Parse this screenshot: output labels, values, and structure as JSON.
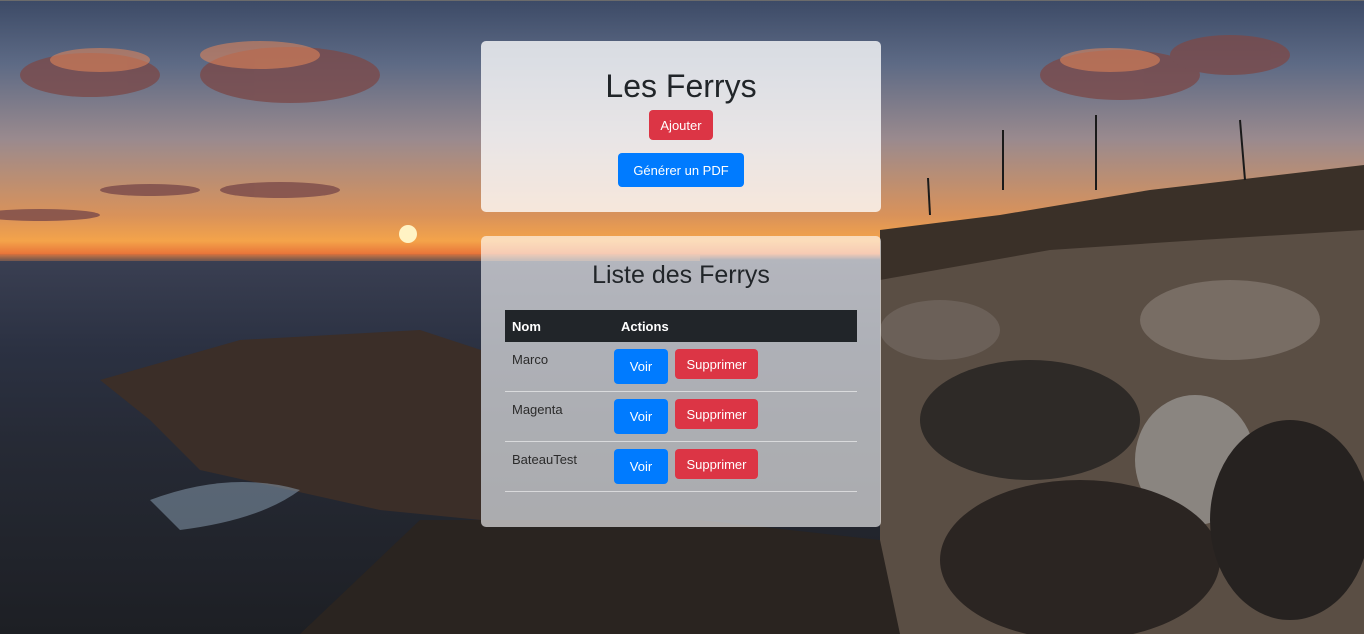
{
  "background": {
    "scene": "coastal-sunset-photo"
  },
  "header_card": {
    "title": "Les Ferrys",
    "add_button": "Ajouter",
    "pdf_button": "Générer un PDF"
  },
  "list_card": {
    "title": "Liste des Ferrys",
    "columns": [
      "Nom",
      "Actions"
    ],
    "rows": [
      {
        "name": "Marco",
        "view": "Voir",
        "delete": "Supprimer"
      },
      {
        "name": "Magenta",
        "view": "Voir",
        "delete": "Supprimer"
      },
      {
        "name": "BateauTest",
        "view": "Voir",
        "delete": "Supprimer"
      }
    ]
  },
  "colors": {
    "danger": "#dc3545",
    "primary": "#007bff",
    "table_header": "#212529"
  }
}
